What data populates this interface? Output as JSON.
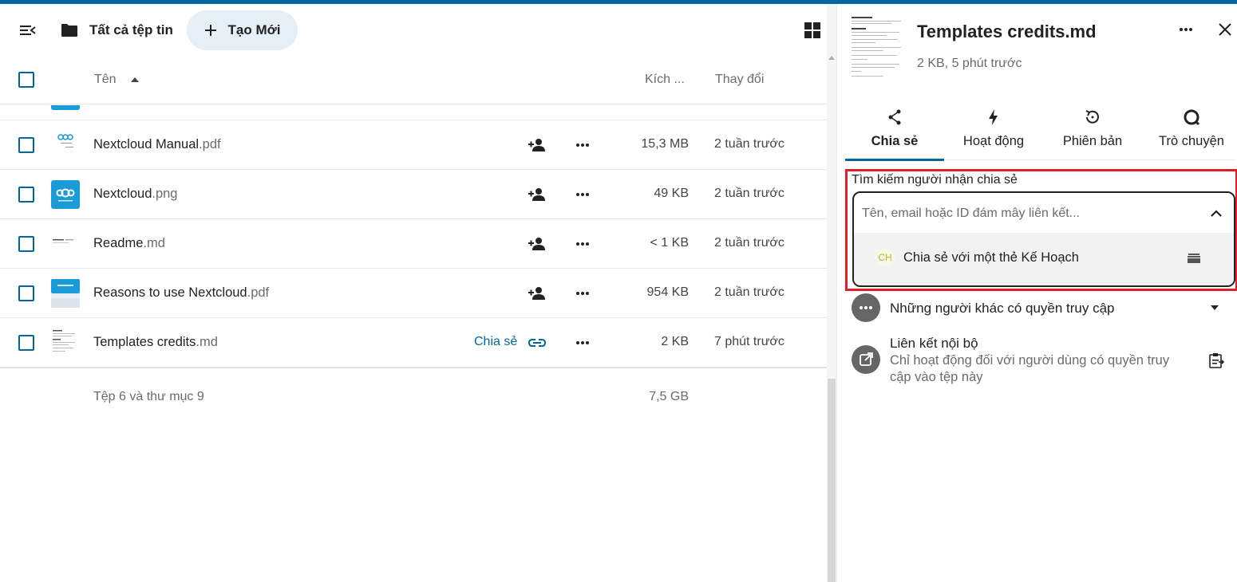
{
  "header": {
    "breadcrumb": "Tất cả tệp tin",
    "new_button": "Tạo Mới"
  },
  "table": {
    "col_name": "Tên",
    "col_size": "Kích ...",
    "col_modified": "Thay đổi"
  },
  "files": [
    {
      "name": "Nextcloud Manual",
      "ext": ".pdf",
      "size": "15,3 MB",
      "modified": "2 tuần trước"
    },
    {
      "name": "Nextcloud",
      "ext": ".png",
      "size": "49 KB",
      "modified": "2 tuần trước"
    },
    {
      "name": "Readme",
      "ext": ".md",
      "size": "< 1 KB",
      "modified": "2 tuần trước"
    },
    {
      "name": "Reasons to use Nextcloud",
      "ext": ".pdf",
      "size": "954 KB",
      "modified": "2 tuần trước"
    },
    {
      "name": "Templates credits",
      "ext": ".md",
      "size": "2 KB",
      "modified": "7 phút trước",
      "share_label": "Chia sẻ"
    }
  ],
  "summary": {
    "text": "Tệp 6 và thư mục 9",
    "size": "7,5 GB"
  },
  "sidebar": {
    "title": "Templates credits.md",
    "subtitle": "2 KB, 5 phút trước",
    "tabs": [
      {
        "label": "Chia sẻ",
        "icon": "share-icon"
      },
      {
        "label": "Hoạt động",
        "icon": "lightning-icon"
      },
      {
        "label": "Phiên bản",
        "icon": "history-icon"
      },
      {
        "label": "Trò chuyện",
        "icon": "chat-icon"
      }
    ],
    "search_label": "Tìm kiếm người nhận chia sẻ",
    "search_placeholder": "Tên, email hoặc ID đám mây liên kết...",
    "option_avatar": "CH",
    "option_label": "Chia sẻ với một thẻ Kế Hoạch",
    "others_label": "Những người khác có quyền truy cập",
    "internal_link_title": "Liên kết nội bộ",
    "internal_link_desc": "Chỉ hoạt động đối với người dùng có quyền truy cập vào tệp này"
  },
  "colors": {
    "accent": "#00679e",
    "highlight": "#e41e26",
    "new_button_bg": "#e5eff5"
  }
}
